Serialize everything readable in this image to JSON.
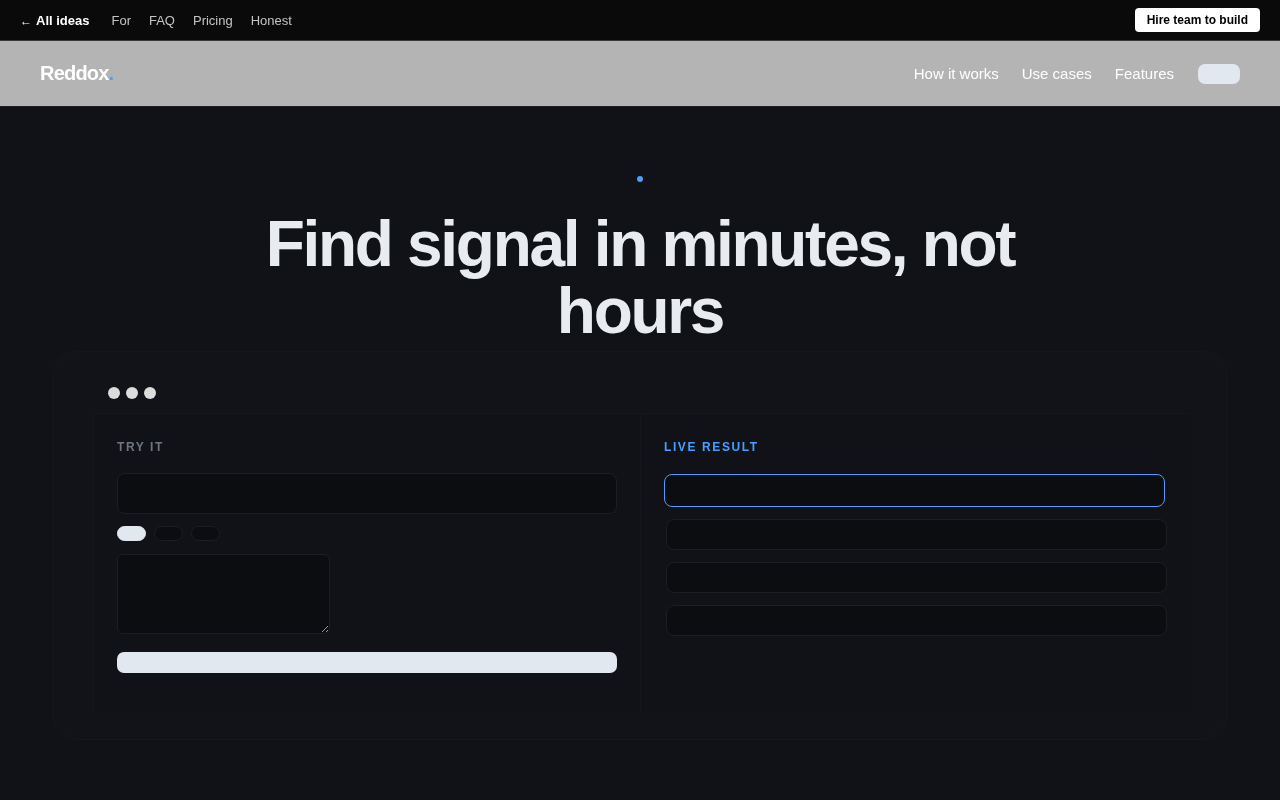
{
  "top_bar": {
    "back_link": {
      "arrow": "←",
      "label": "All ideas"
    },
    "links": [
      "For",
      "FAQ",
      "Pricing",
      "Honest"
    ],
    "cta": "Hire team to build"
  },
  "header": {
    "logo": {
      "name": "Reddox",
      "mark": "."
    },
    "nav": [
      "How it works",
      "Use cases",
      "Features"
    ]
  },
  "hero": {
    "title": "Find signal in minutes, not hours"
  },
  "demo": {
    "input_panel": {
      "label": "TRY IT",
      "options": [
        {
          "selected": true
        },
        {
          "selected": false
        },
        {
          "selected": false
        }
      ]
    },
    "result_panel": {
      "label": "LIVE RESULT",
      "results": [
        {
          "selected": true
        },
        {
          "selected": false
        },
        {
          "selected": false
        },
        {
          "selected": false
        }
      ]
    }
  }
}
